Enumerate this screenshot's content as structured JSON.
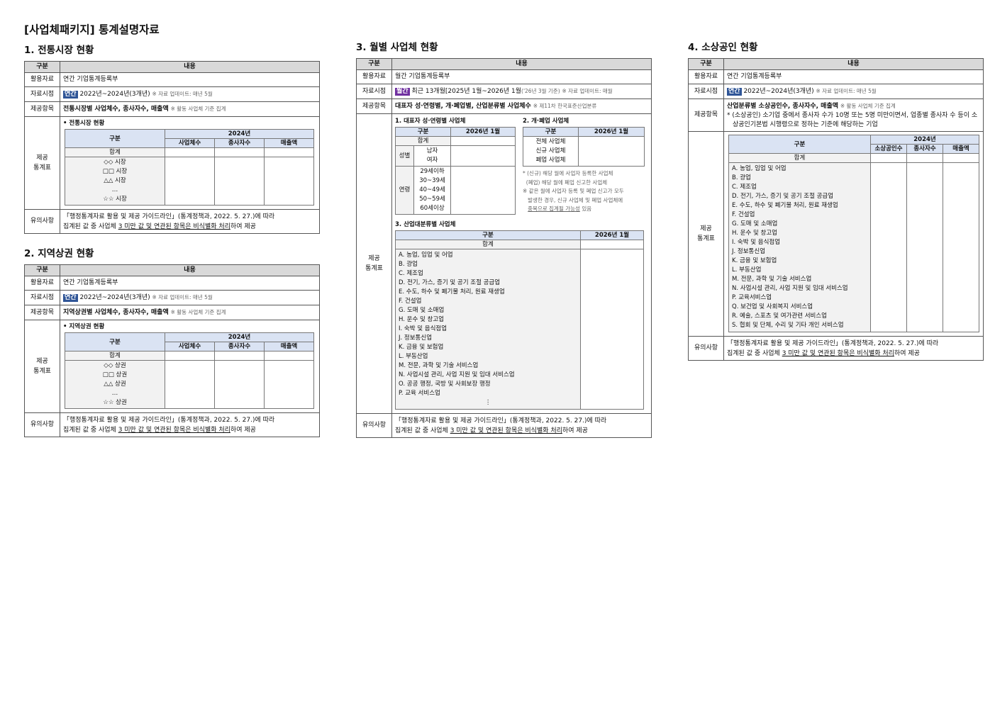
{
  "doc_title": "[사업체패키지]  통계설명자료",
  "common": {
    "col_label": "구분",
    "col_content": "내용",
    "row_usage": "활용자료",
    "row_period": "자료시점",
    "row_items": "제공항목",
    "row_table": "제공\n통계표",
    "row_caution": "유의사항",
    "yr2024": "2024년",
    "m_biz": "사업체수",
    "m_emp": "종사자수",
    "m_sales": "매출액",
    "total": "합계",
    "ellipsis": "…",
    "update_annual": "※ 자료 업데이트: 매년 5월",
    "caution_line1": "「행정통계자료 활용 및 제공 가이드라인」(통계정책과, 2022. 5. 27.)에 따라",
    "caution_pre": "집계된 값 중 사업체 ",
    "caution_ul": "3 미만 값 및 연관된 항목은 비식별화 처리",
    "caution_post": "하여 제공"
  },
  "s1": {
    "title": "1. 전통시장  현황",
    "usage": "연간 기업통계등록부",
    "badge": "연간",
    "period": "2022년~2024년(3개년)",
    "items_main": "전통시장별 사업체수, 종사자수, 매출액",
    "items_note": "※ 활동 사업체 기준 집계",
    "box_title": "• 전통시장  현황",
    "rows": [
      "◇◇ 시장",
      "□□ 시장",
      "△△ 시장",
      "…",
      "☆☆ 시장"
    ]
  },
  "s2": {
    "title": "2. 지역상권  현황",
    "usage": "연간 기업통계등록부",
    "badge": "연간",
    "period": "2022년~2024년(3개년)",
    "items_main": "지역상권별 사업체수, 종사자수, 매출액",
    "items_note": "※ 활동 사업체 기준 집계",
    "box_title": "• 지역상권  현황",
    "rows": [
      "◇◇ 상권",
      "□□ 상권",
      "△△ 상권",
      "…",
      "☆☆ 상권"
    ]
  },
  "s3": {
    "title": "3. 월별  사업체  현황",
    "usage": "월간 기업통계등록부",
    "badge": "월간",
    "period": "최근 13개월[2025년 1월~2026년 1월",
    "period_small": "('26년 3월 기준)",
    "update": "※ 자료 업데이트: 매월",
    "items_main": "대표자 성·연령별, 개·폐업별, 산업분류별 사업체수",
    "items_note": "※ 제11차 한국표준산업분류",
    "t1_title": "1. 대표자 성·연령별 사업체",
    "t2_title": "2. 개·폐업 사업체",
    "t3_title": "3. 산업대분류별 사업체",
    "month": "2026년 1월",
    "sex_label": "성별",
    "sex": [
      "남자",
      "여자"
    ],
    "age_label": "연령",
    "ages": [
      "29세이하",
      "30~39세",
      "40~49세",
      "50~59세",
      "60세이상"
    ],
    "openclose": [
      "전체 사업체",
      "신규 사업체",
      "폐업 사업체"
    ],
    "note1": "* (신규) 해당 월에 사업자 등록한 사업체",
    "note2": "  (폐업) 해당 월에 폐업 신고한 사업체",
    "note3": "※ 같은 월에 사업자 등록 및 폐업 신고가 모두",
    "note4": "   발생한 경우, 신규 사업체 및 폐업 사업체에",
    "note5_ul": "중복으로 집계될 가능성",
    "note5_post": " 있음",
    "industries": [
      "A. 농업, 임업 및 어업",
      "B. 광업",
      "C. 제조업",
      "D. 전기, 가스, 증기 및 공기 조절 공급업",
      "E. 수도, 하수 및 폐기물 처리, 원료 재생업",
      "F. 건설업",
      "G. 도매 및 소매업",
      "H. 운수 및 창고업",
      "I. 숙박 및 음식점업",
      "J. 정보통신업",
      "K. 금융 및 보험업",
      "L. 부동산업",
      "M. 전문, 과학 및 기술 서비스업",
      "N. 사업시설 관리, 사업 지원 및 임대 서비스업",
      "O. 공공 행정, 국방 및 사회보장 행정",
      "P. 교육 서비스업",
      "⋮"
    ]
  },
  "s4": {
    "title": "4. 소상공인  현황",
    "usage": "연간 기업통계등록부",
    "badge": "연간",
    "period": "2022년~2024년(3개년)",
    "items_main": "산업분류별 소상공인수, 종사자수, 매출액",
    "items_note": "※ 활동 사업체 기준 집계",
    "items_note2": "* (소상공인) 소기업 중에서 종사자 수가 10명 또는 5명 미만이면서, 업종별 종사자 수 등이 소상공인기본법 시행령으로 정하는 기준에 해당하는 기업",
    "m_owners": "소상공인수",
    "industries": [
      "A. 농업, 임업 및 어업",
      "B. 광업",
      "C. 제조업",
      "D. 전기, 가스, 증기 및 공기 조절 공급업",
      "E. 수도, 하수 및 폐기물 처리, 원료 재생업",
      "F. 건설업",
      "G. 도매 및 소매업",
      "H. 운수 및 창고업",
      "I. 숙박 및 음식점업",
      "J. 정보통신업",
      "K. 금융 및 보험업",
      "L. 부동산업",
      "M. 전문, 과학 및 기술 서비스업",
      "N. 사업시설 관리, 사업 지원 및 임대 서비스업",
      "P. 교육서비스업",
      "Q. 보건업 및 사회복지 서비스업",
      "R. 예술, 스포츠 및 여가관련 서비스업",
      "S. 협회 및 단체, 수리 및 기타 개인 서비스업"
    ]
  }
}
